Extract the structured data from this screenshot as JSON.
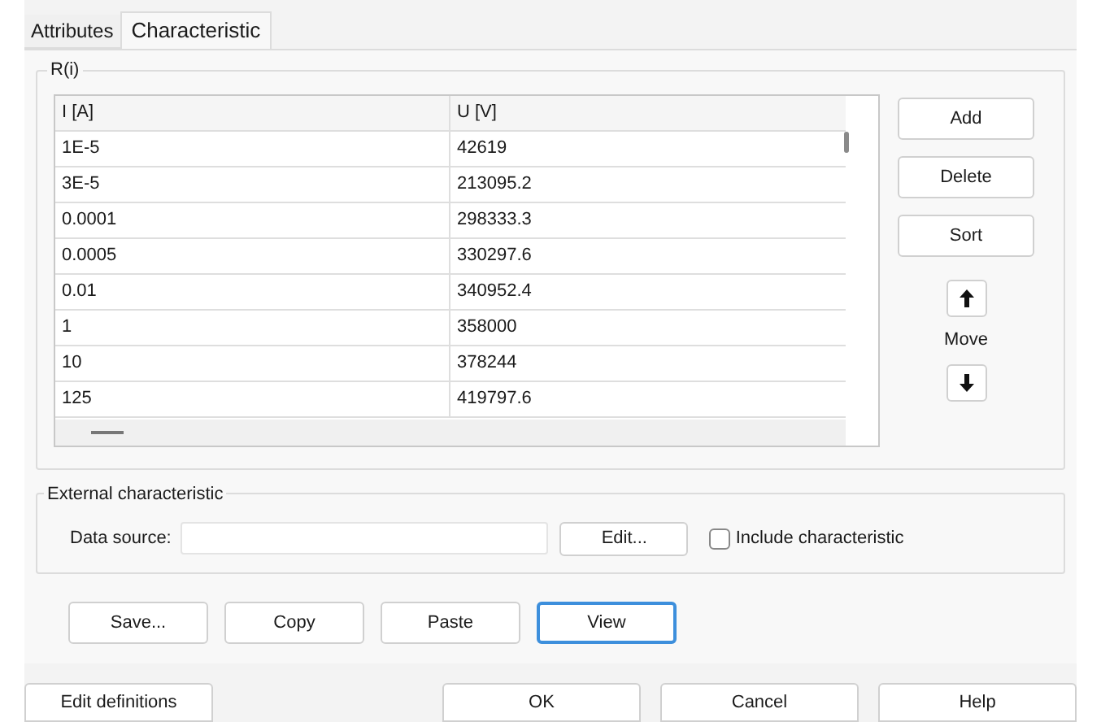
{
  "tabs": [
    {
      "label": "Attributes",
      "selected": false
    },
    {
      "label": "Characteristic",
      "selected": true
    }
  ],
  "group_title": "R(i)",
  "table": {
    "columns": [
      "I [A]",
      "U [V]"
    ],
    "rows": [
      [
        "1E-5",
        "42619"
      ],
      [
        "3E-5",
        "213095.2"
      ],
      [
        "0.0001",
        "298333.3"
      ],
      [
        "0.0005",
        "330297.6"
      ],
      [
        "0.01",
        "340952.4"
      ],
      [
        "1",
        "358000"
      ],
      [
        "10",
        "378244"
      ],
      [
        "125",
        "419797.6"
      ]
    ]
  },
  "side_buttons": [
    "Add",
    "Delete",
    "Sort"
  ],
  "move_label": "Move",
  "external": {
    "title": "External characteristic",
    "label": "Data source:",
    "edit_button": "Edit...",
    "include": {
      "label": "Include characteristic",
      "checked": false
    }
  },
  "action_buttons": [
    {
      "label": "Save...",
      "focused": false
    },
    {
      "label": "Copy",
      "focused": false
    },
    {
      "label": "Paste",
      "focused": false
    },
    {
      "label": "View",
      "focused": true
    }
  ],
  "footer": {
    "left_button": "Edit definitions",
    "buttons": [
      "OK",
      "Cancel",
      "Help"
    ]
  }
}
